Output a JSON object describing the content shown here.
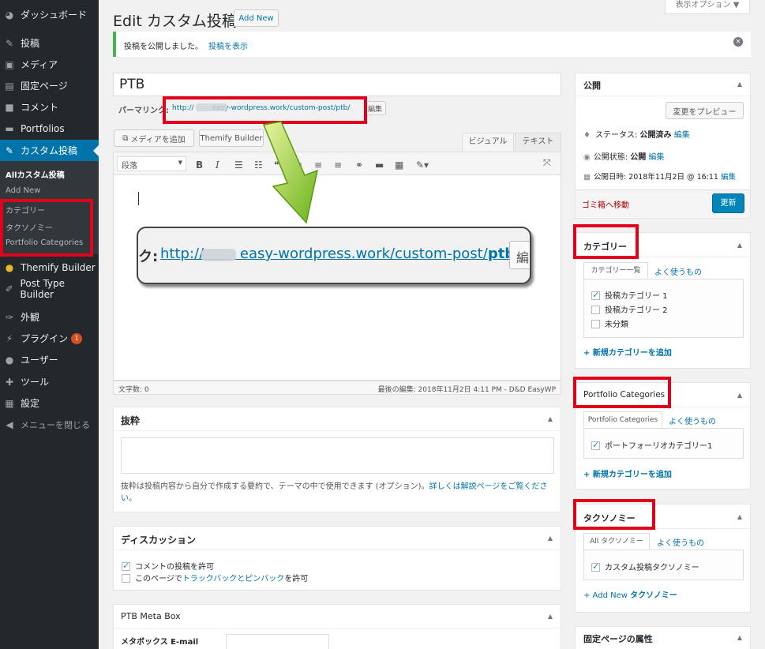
{
  "sidebar": {
    "dashboard": "ダッシュボード",
    "posts": "投稿",
    "media": "メディア",
    "pages": "固定ページ",
    "comments": "コメント",
    "portfolios": "Portfolios",
    "custom": "カスタム投稿",
    "sub_all": "Allカスタム投稿",
    "sub_add": "Add New",
    "sub_cat": "カテゴリー",
    "sub_tax": "タクソノミー",
    "sub_pc": "Portfolio Categories",
    "themify": "Themify Builder",
    "ptb": "Post Type Builder",
    "appearance": "外観",
    "plugins": "プラグイン",
    "plugins_badge": "1",
    "users": "ユーザー",
    "tools": "ツール",
    "settings": "設定",
    "collapse": "メニューを閉じる"
  },
  "header": {
    "title": "Edit カスタム投稿",
    "add_new": "Add New",
    "screen_options": "表示オプション ▼"
  },
  "notice": {
    "text": "投稿を公開しました。",
    "link": "投稿を表示"
  },
  "editor": {
    "post_title": "PTB",
    "permalink_label": "パーマリンク:",
    "permalink_url": "http://        easy-wordpress.work/custom-post/ptb/",
    "permalink_edit": "編集",
    "add_media": "メディアを追加",
    "themify_builder": "Themify Builder",
    "tab_visual": "ビジュアル",
    "tab_text": "テキスト",
    "format": "段落",
    "zoom_prefix": "ク:",
    "zoom_url": "http://        easy-wordpress.work/custom-post/",
    "zoom_bold": "ptb/",
    "zoom_edit": "編",
    "word_count": "文字数: 0",
    "last_edit": "最後の編集: 2018年11月2日 4:11 PM - D&D EasyWP"
  },
  "excerpt": {
    "title": "抜粋",
    "desc": "抜粋は投稿内容から自分で作成する要約で、テーマの中で使用できます (オプション)。",
    "link": "詳しくは解説ページをご覧ください",
    "end": "。"
  },
  "discussion": {
    "title": "ディスカッション",
    "allow_comments": "コメントの投稿を許可",
    "pings_pre": "このページで",
    "pings_link": "トラックバックとピンバック",
    "pings_post": "を許可"
  },
  "metabox": {
    "title": "PTB Meta Box",
    "field_label": "メタボックス E-mail"
  },
  "publish": {
    "title": "公開",
    "preview": "変更をプレビュー",
    "status_label": "ステータス:",
    "status_value": "公開済み",
    "visibility_label": "公開状態:",
    "visibility_value": "公開",
    "date_label": "公開日時:",
    "date_value": "2018年11月2日 @ 16:11",
    "edit": "編集",
    "trash": "ゴミ箱へ移動",
    "update": "更新"
  },
  "categories": {
    "title": "カテゴリー",
    "tab_all": "カテゴリー一覧",
    "tab_popular": "よく使うもの",
    "items": [
      {
        "label": "投稿カテゴリー 1",
        "checked": true
      },
      {
        "label": "投稿カテゴリー 2",
        "checked": false
      },
      {
        "label": "未分類",
        "checked": false
      }
    ],
    "add": "+ 新規カテゴリーを追加"
  },
  "portfolio": {
    "title": "Portfolio Categories",
    "tab_all": "Portfolio Categories",
    "tab_popular": "よく使うもの",
    "item": "ポートフォーリオカテゴリー1",
    "add": "+ 新規カテゴリーを追加"
  },
  "taxonomy": {
    "title": "タクソノミー",
    "tab_all": "All タクソノミー",
    "tab_popular": "よく使うもの",
    "item": "カスタム投稿タクソノミー",
    "add_pre": "+ Add New ",
    "add_bold": "タクソノミー"
  },
  "page_attrs": {
    "title": "固定ページの属性"
  },
  "colors": {
    "sidebar": "#23282d",
    "active": "#0073aa",
    "highlight": "#e3001b",
    "arrow": "#8dc21f"
  }
}
